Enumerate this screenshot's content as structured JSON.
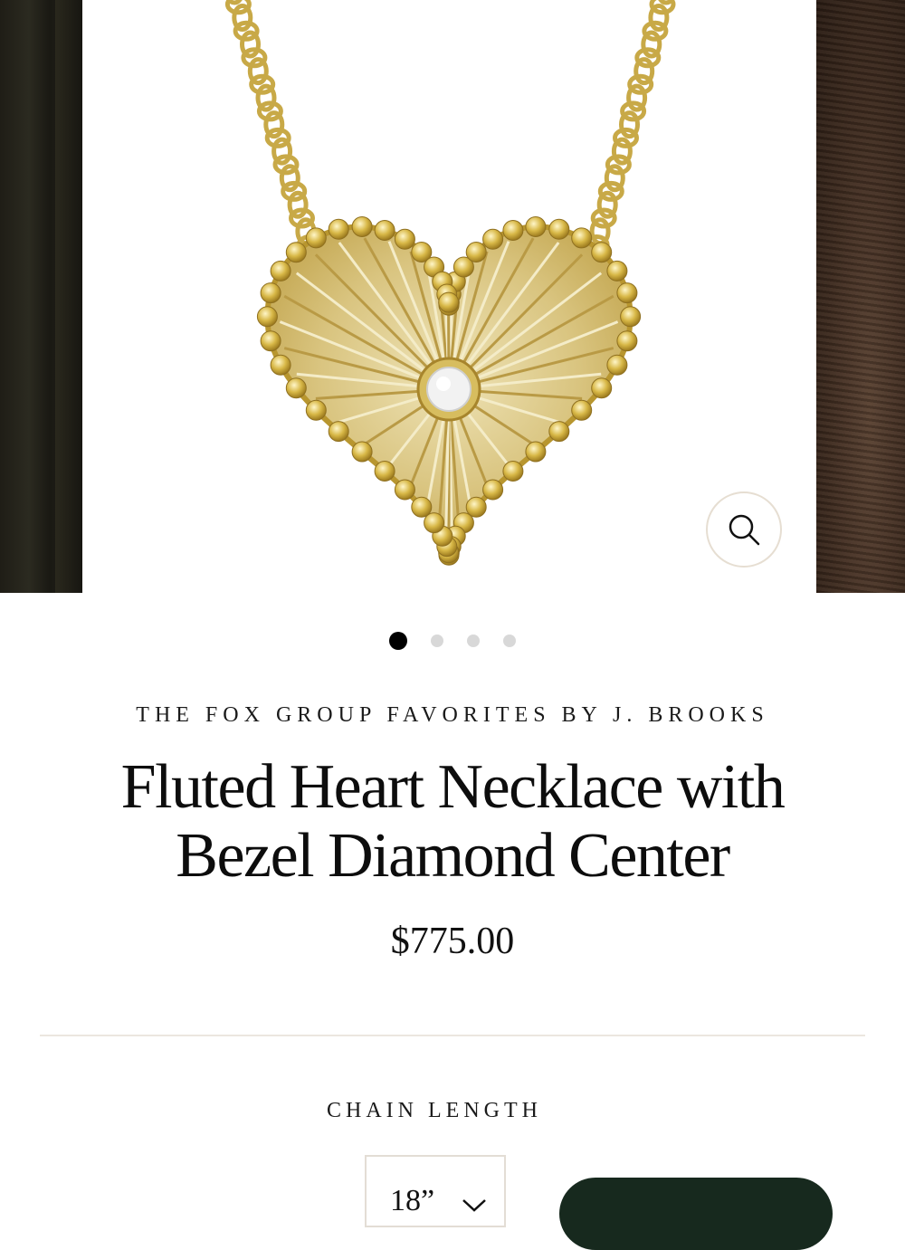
{
  "gallery": {
    "dots_count": 4,
    "active_index": 0,
    "zoom_icon": "search-icon"
  },
  "product": {
    "vendor": "THE FOX GROUP FAVORITES BY J. BROOKS",
    "title_line1": "Fluted Heart Necklace with",
    "title_line2": "Bezel Diamond Center",
    "price": "$775.00"
  },
  "options": {
    "label": "CHAIN LENGTH",
    "selected_value": "18”"
  },
  "colors": {
    "cta_bg": "#17291e",
    "divider": "#ece6df",
    "gold": "#c9ad52"
  }
}
